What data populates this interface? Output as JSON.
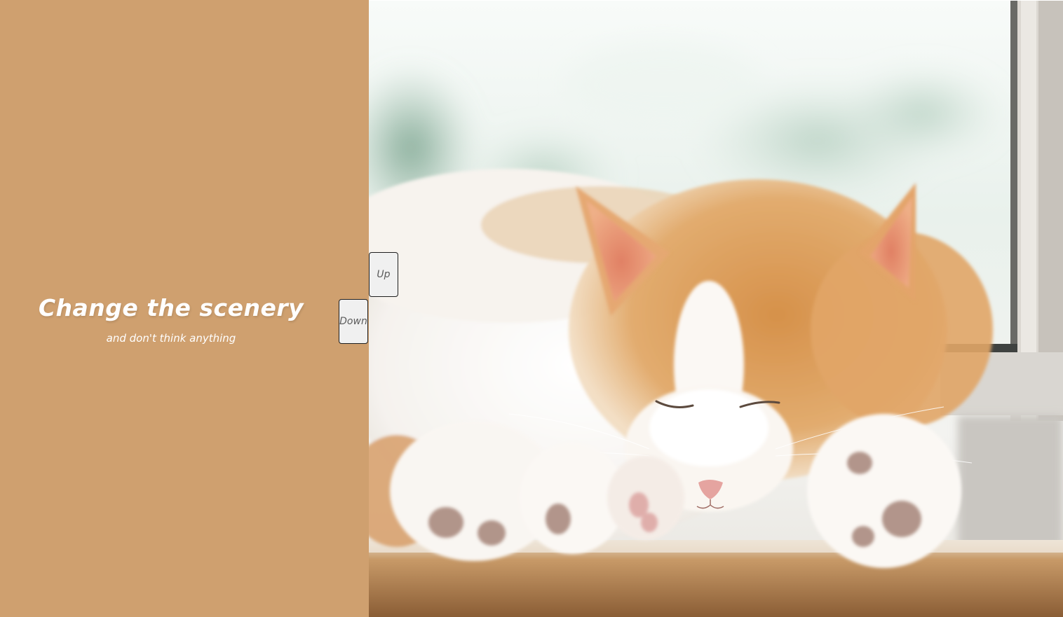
{
  "slider": {
    "title": "Change the scenery",
    "subtitle": "and don't think anything",
    "left_panel_color": "#cfa06f",
    "image_subject": "sleeping orange and white cat on a windowsill",
    "buttons": {
      "up_label": "Up",
      "down_label": "Down"
    }
  }
}
